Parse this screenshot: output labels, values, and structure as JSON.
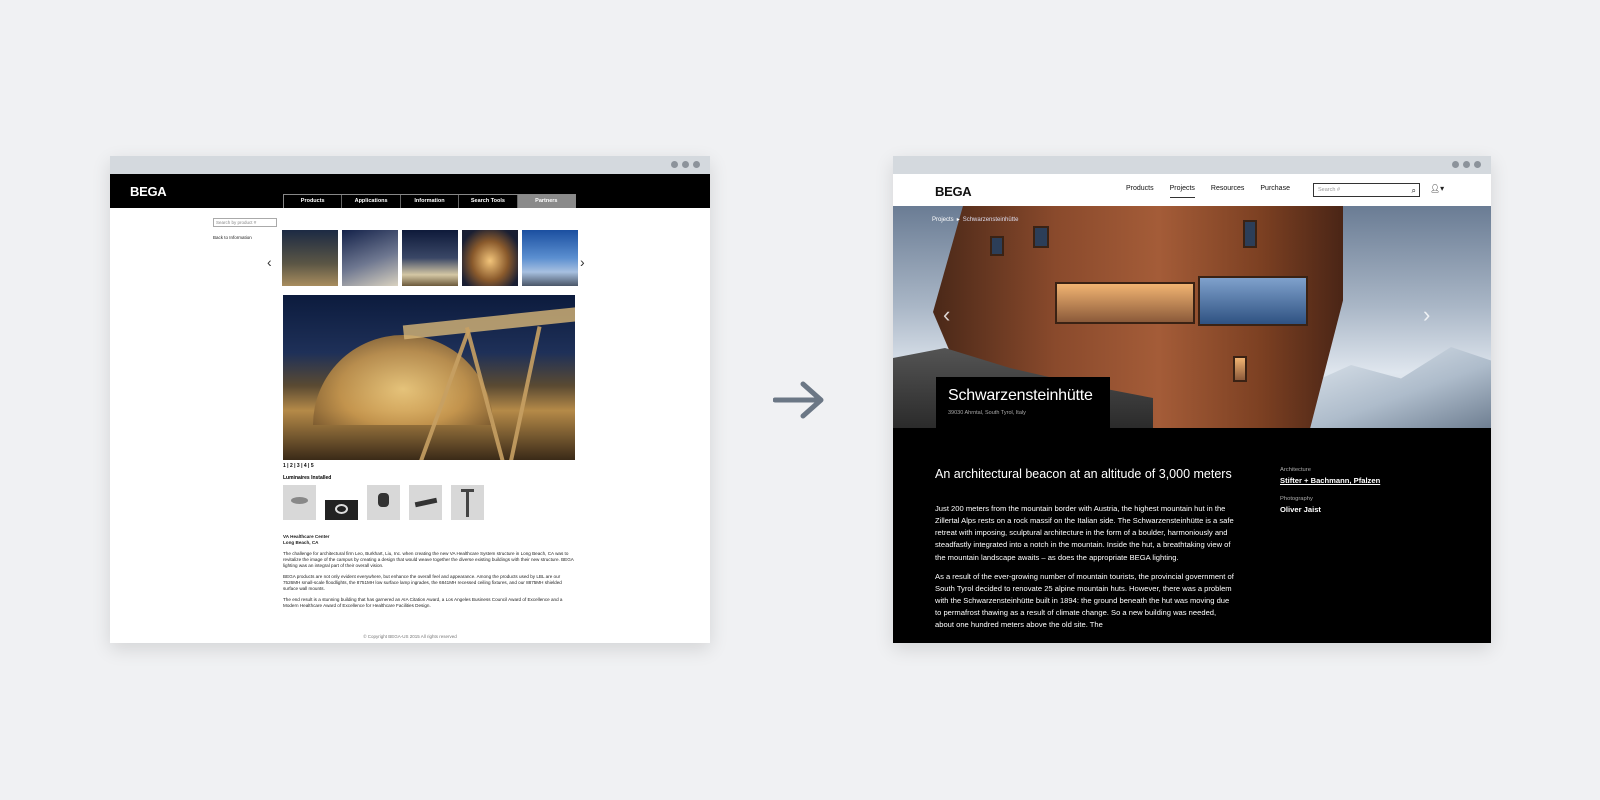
{
  "old_site": {
    "logo": "BEGA",
    "nav": [
      "Products",
      "Applications",
      "Information",
      "Search Tools",
      "Partners"
    ],
    "search_placeholder": "Search by product #",
    "back_link": "Back to Information",
    "pagination": "1 | 2 | 3 | 4 | 5",
    "luminaires_title": "Luminaires Installed",
    "project_name": "VA Healthcare Center",
    "project_location": "Long Beach, CA",
    "paragraphs": [
      "The challenge for architectural firm Leo, Burkhart, Liu, Inc. when creating the new VA Healthcare System structure in Long Beach, CA was to revitalize the image of the campus by creating a design that would weave together the diverse existing buildings with their new structure. BEGA lighting was an integral part of their overall vision.",
      "BEGA products are not only evident everywhere, but enhance the overall feel and appearance. Among the products used by LBL are our 7526MH small-scale floodlights, the 8751MH low surface lamp ingrades, the 6841MH recessed ceiling fixtures, and our 8875MH shielded surface wall mounts.",
      "The end result is a stunning building that has garnered an AIA Citation Award, a Los Angeles Business Council Award of Excellence and a Modern Healthcare Award of Excellence for Healthcare Facilities Design."
    ],
    "copyright": "© Copyright BEGA-US 2015 All rights reserved"
  },
  "new_site": {
    "logo": "BEGA",
    "nav": [
      "Products",
      "Projects",
      "Resources",
      "Purchase"
    ],
    "active_nav": "Projects",
    "search_placeholder": "Search #",
    "breadcrumb": [
      "Projects",
      "Schwarzensteinhütte"
    ],
    "title": "Schwarzensteinhütte",
    "subtitle": "39030 Ahrntal, South Tyrol, Italy",
    "heading": "An architectural beacon at an altitude of 3,000 meters",
    "paragraphs": [
      "Just 200 meters from the mountain border with Austria, the highest mountain hut in the Zillertal Alps rests on a rock massif on the Italian side. The Schwarzensteinhütte is a safe retreat with imposing, sculptural architecture in the form of a boulder, harmoniously and steadfastly integrated into a notch in the mountain. Inside the hut, a breathtaking view of the mountain landscape awaits – as does the appropriate BEGA lighting.",
      "As a result of the ever-growing number of mountain tourists, the provincial government of South Tyrol decided to renovate 25 alpine mountain huts. However, there was a problem with the Schwarzensteinhütte built in 1894: the ground beneath the hut was moving due to permafrost thawing as a result of climate change. So a new building was needed, about one hundred meters above the old site. The"
    ],
    "meta": {
      "architecture_label": "Architecture",
      "architecture_value": "Stifter + Bachmann, Pfalzen",
      "photography_label": "Photography",
      "photography_value": "Oliver Jaist"
    }
  },
  "colors": {
    "background": "#f0f1f3",
    "window_bar": "#d4d9de",
    "arrow": "#6b7785"
  }
}
